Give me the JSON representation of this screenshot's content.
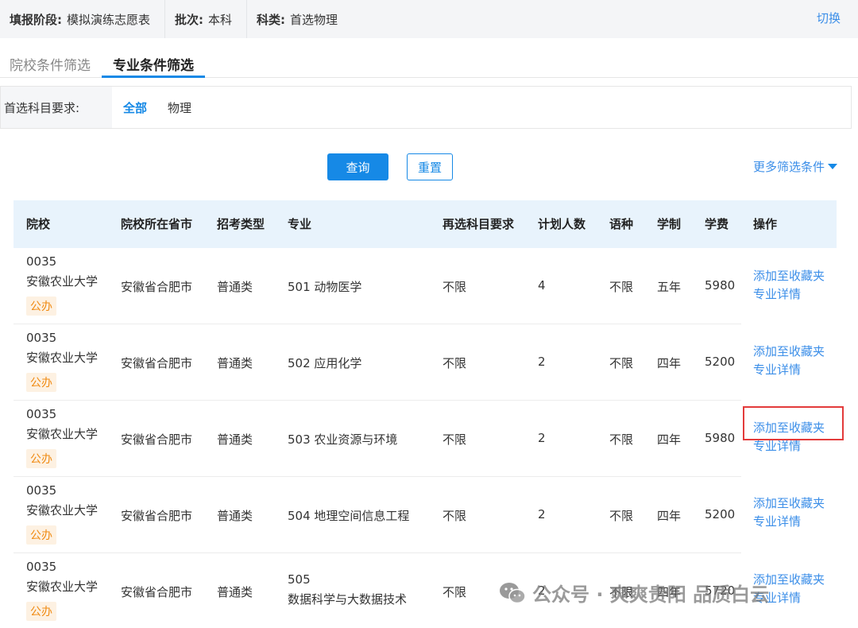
{
  "topbar": {
    "stage_key": "填报阶段:",
    "stage_val": "模拟演练志愿表",
    "batch_key": "批次:",
    "batch_val": "本科",
    "subject_key": "科类:",
    "subject_val": "首选物理",
    "switch_label": "切换"
  },
  "tabs": {
    "school": "院校条件筛选",
    "major": "专业条件筛选"
  },
  "filter": {
    "label": "首选科目要求:",
    "opt_all": "全部",
    "opt_physics": "物理"
  },
  "buttons": {
    "query": "查询",
    "reset": "重置",
    "more": "更多筛选条件"
  },
  "table": {
    "headers": [
      "院校",
      "院校所在省市",
      "招考类型",
      "专业",
      "再选科目要求",
      "计划人数",
      "语种",
      "学制",
      "学费",
      "操作"
    ],
    "rows": [
      {
        "code": "0035",
        "uni": "安徽农业大学",
        "badge": "公办",
        "city": "安徽省合肥市",
        "type": "普通类",
        "major": "501 动物医学",
        "major2": "",
        "req": "不限",
        "plan": "4",
        "lang": "不限",
        "years": "五年",
        "fee": "5980",
        "op1": "添加至收藏夹",
        "op2": "专业详情"
      },
      {
        "code": "0035",
        "uni": "安徽农业大学",
        "badge": "公办",
        "city": "安徽省合肥市",
        "type": "普通类",
        "major": "502 应用化学",
        "major2": "",
        "req": "不限",
        "plan": "2",
        "lang": "不限",
        "years": "四年",
        "fee": "5200",
        "op1": "添加至收藏夹",
        "op2": "专业详情"
      },
      {
        "code": "0035",
        "uni": "安徽农业大学",
        "badge": "公办",
        "city": "安徽省合肥市",
        "type": "普通类",
        "major": "503 农业资源与环境",
        "major2": "",
        "req": "不限",
        "plan": "2",
        "lang": "不限",
        "years": "四年",
        "fee": "5980",
        "op1": "添加至收藏夹",
        "op2": "专业详情"
      },
      {
        "code": "0035",
        "uni": "安徽农业大学",
        "badge": "公办",
        "city": "安徽省合肥市",
        "type": "普通类",
        "major": "504 地理空间信息工程",
        "major2": "",
        "req": "不限",
        "plan": "2",
        "lang": "不限",
        "years": "四年",
        "fee": "5200",
        "op1": "添加至收藏夹",
        "op2": "专业详情"
      },
      {
        "code": "0035",
        "uni": "安徽农业大学",
        "badge": "公办",
        "city": "安徽省合肥市",
        "type": "普通类",
        "major": "505",
        "major2": "数据科学与大数据技术",
        "req": "不限",
        "plan": "2",
        "lang": "不限",
        "years": "四年",
        "fee": "5720",
        "op1": "添加至收藏夹",
        "op2": "专业详情"
      }
    ]
  },
  "watermark": "公众号 · 爽爽贵阳 品质白云",
  "colors": {
    "accent": "#1689e6",
    "badge": "#f08a12",
    "highlight": "#e33b3b"
  }
}
